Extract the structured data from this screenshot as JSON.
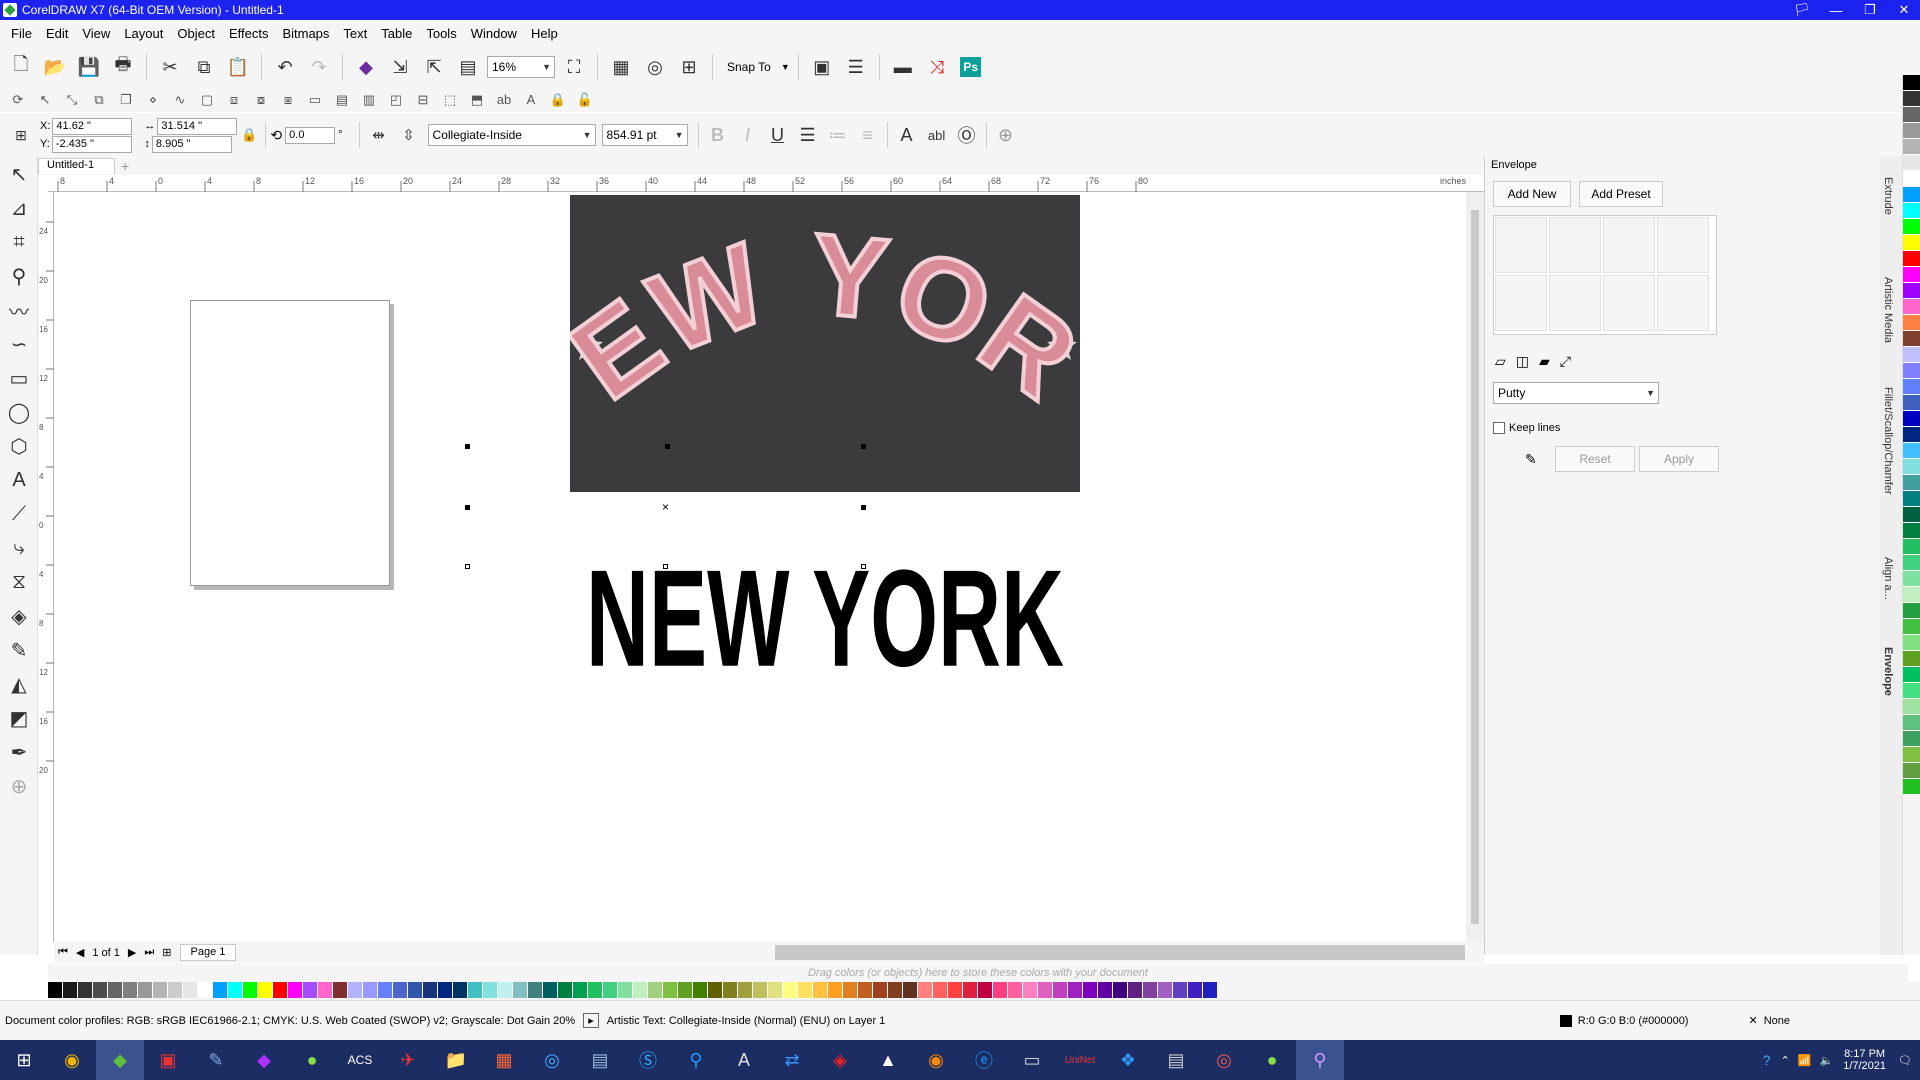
{
  "window": {
    "title": "CorelDRAW X7 (64-Bit OEM Version) - Untitled-1",
    "controls": [
      "🏳",
      "—",
      "❐",
      "✕"
    ]
  },
  "menu": [
    "File",
    "Edit",
    "View",
    "Layout",
    "Object",
    "Effects",
    "Bitmaps",
    "Text",
    "Table",
    "Tools",
    "Window",
    "Help"
  ],
  "toolbar": {
    "zoom": "16%",
    "snap_to": "Snap To"
  },
  "property_bar": {
    "x": "41.62 \"",
    "y": "-2.435 \"",
    "width": "31.514 \"",
    "height": "8.905 \"",
    "angle": "0.0",
    "angle_unit": "°",
    "font": "Collegiate-Inside",
    "font_size": "854.91 pt",
    "x_label": "X:",
    "y_label": "Y:"
  },
  "document_tab": "Untitled-1",
  "ruler": {
    "unit": "inches",
    "h_ticks": [
      "8",
      "4",
      "0",
      "4",
      "8",
      "12",
      "16",
      "20",
      "24",
      "28",
      "32",
      "36",
      "40",
      "44",
      "48",
      "52",
      "56",
      "60",
      "64",
      "68",
      "72",
      "76",
      "80"
    ],
    "v_ticks": [
      "24",
      "20",
      "16",
      "12",
      "8",
      "4",
      "0",
      "4",
      "8",
      "12",
      "16",
      "20"
    ]
  },
  "canvas": {
    "artistic_text": "NEW YORK",
    "photo_text": "NEW YORK"
  },
  "page_nav": {
    "count": "1 of 1",
    "page": "Page 1"
  },
  "color_well_hint": "Drag colors (or objects) here to store these colors with your document",
  "status": {
    "profiles": "Document color profiles: RGB: sRGB IEC61966-2.1; CMYK: U.S. Web Coated (SWOP) v2; Grayscale: Dot Gain 20%",
    "object": "Artistic Text: Collegiate-Inside (Normal) (ENU) on Layer 1",
    "fill": "R:0 G:0 B:0 (#000000)",
    "outline": "None"
  },
  "envelope": {
    "title": "Envelope",
    "add_new": "Add New",
    "add_preset": "Add Preset",
    "mode": "Putty",
    "keep_lines": "Keep lines",
    "reset": "Reset",
    "apply": "Apply"
  },
  "docker_tabs": [
    "Extrude",
    "Artistic Media",
    "Fillet/Scallop/Chamfer",
    "Align a...",
    "Envelope"
  ],
  "clock": {
    "time": "8:17 PM",
    "date": "1/7/2021"
  },
  "colors": {
    "palette": [
      "#000000",
      "#1a1a1a",
      "#333333",
      "#4d4d4d",
      "#666666",
      "#808080",
      "#999999",
      "#b3b3b3",
      "#cccccc",
      "#e6e6e6",
      "#ffffff",
      "#00a0ff",
      "#00ffff",
      "#00ff00",
      "#ffff00",
      "#ff0000",
      "#ff00ff",
      "#a64dff",
      "#ff66cc",
      "#803030",
      "#b3b3ff",
      "#9999ff",
      "#6680ff",
      "#4d66cc",
      "#3355aa",
      "#1a337f",
      "#00267f",
      "#003366",
      "#40c0c0",
      "#80e0e0",
      "#c0f0f0",
      "#80c0c0",
      "#408080",
      "#006060",
      "#008040",
      "#00a050",
      "#20c060",
      "#40d080",
      "#80e0a0",
      "#c0f0c0",
      "#a0d080",
      "#80c040",
      "#60a020",
      "#408000",
      "#606000",
      "#808020",
      "#a0a040",
      "#c0c060",
      "#e0e080",
      "#ffff80",
      "#ffe060",
      "#ffc040",
      "#ffa020",
      "#e08020",
      "#c06020",
      "#a04020",
      "#804020",
      "#603020",
      "#ff8080",
      "#ff6060",
      "#ff4040",
      "#e02040",
      "#c00040",
      "#ff4080",
      "#ff60a0",
      "#ff80c0",
      "#e060c0",
      "#c040c0",
      "#a020c0",
      "#8000c0",
      "#6000a0",
      "#400080",
      "#602080",
      "#8040a0",
      "#a060c0",
      "#6040c0",
      "#4020c0",
      "#2020c0"
    ],
    "right_palette": [
      "#000000",
      "#333333",
      "#666666",
      "#999999",
      "#b3b3b3",
      "#e6e6e6",
      "#ffffff",
      "#00a0ff",
      "#00ffff",
      "#00ff00",
      "#ffff00",
      "#ff0000",
      "#ff00ff",
      "#a000ff",
      "#ff66cc",
      "#ff8040",
      "#804030",
      "#c0c0ff",
      "#8080ff",
      "#6080ff",
      "#4060c0",
      "#0000c0",
      "#00267f",
      "#40c0ff",
      "#80e0e0",
      "#40a0a0",
      "#008080",
      "#006040",
      "#008040",
      "#20c060",
      "#40d080",
      "#80e0a0",
      "#c0f0c0",
      "#20a040",
      "#40c040",
      "#80e080",
      "#60a020",
      "#00c060",
      "#40e080",
      "#a0e0a0",
      "#60c080",
      "#40a060",
      "#80c040",
      "#60a040",
      "#20c020"
    ]
  }
}
